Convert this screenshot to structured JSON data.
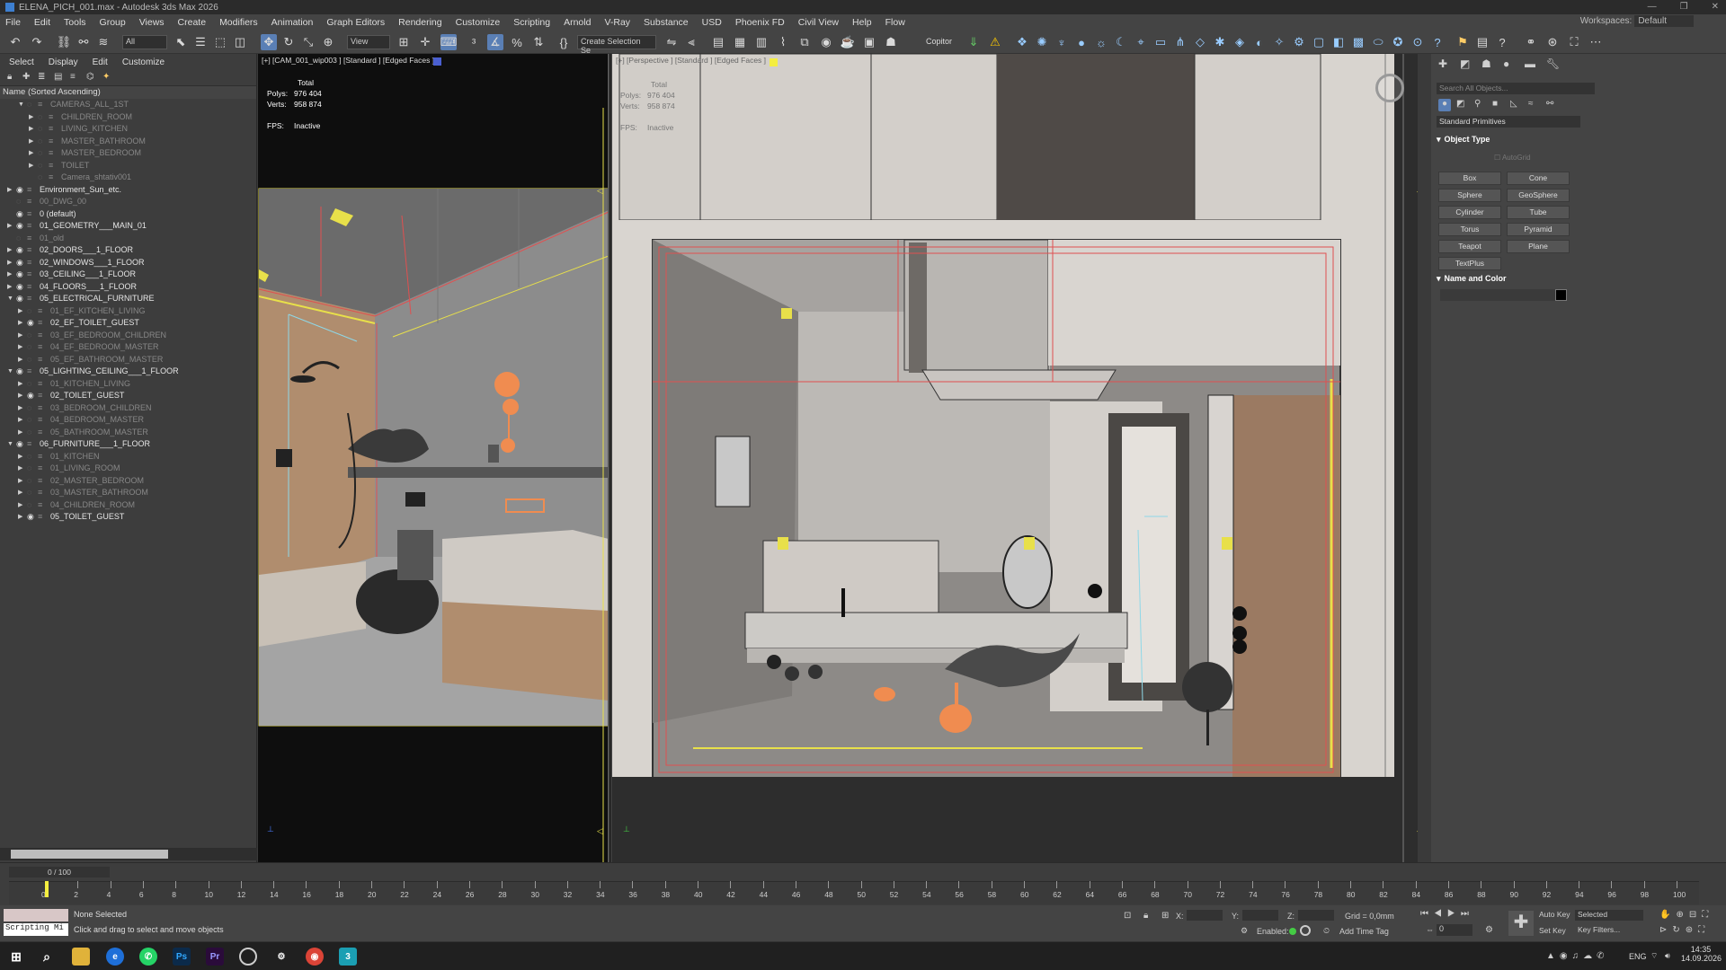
{
  "app": {
    "title": "ELENA_PICH_001.max - Autodesk 3ds Max 2026",
    "workspaces_label": "Workspaces:",
    "workspace": "Default"
  },
  "menu": [
    "File",
    "Edit",
    "Tools",
    "Group",
    "Views",
    "Create",
    "Modifiers",
    "Animation",
    "Graph Editors",
    "Rendering",
    "Customize",
    "Scripting",
    "Arnold",
    "V-Ray",
    "Substance",
    "USD",
    "Phoenix FD",
    "Civil View",
    "Help",
    "Flow"
  ],
  "toolbar": {
    "filter": "All",
    "view_dropdown": "View",
    "selection_set": "Create Selection Se",
    "copitor": "Copitor"
  },
  "scene_explorer": {
    "tabs": [
      "Select",
      "Display",
      "Edit",
      "Customize"
    ],
    "header": "Name (Sorted Ascending)",
    "rows": [
      {
        "label": "CAMERAS_ALL_1ST",
        "lvl": 2,
        "exp": "open",
        "dim": true
      },
      {
        "label": "CHILDREN_ROOM",
        "lvl": 3,
        "exp": "closed",
        "dim": true
      },
      {
        "label": "LIVING_KITCHEN",
        "lvl": 3,
        "exp": "closed",
        "dim": true
      },
      {
        "label": "MASTER_BATHROOM",
        "lvl": 3,
        "exp": "closed",
        "dim": true
      },
      {
        "label": "MASTER_BEDROOM",
        "lvl": 3,
        "exp": "closed",
        "dim": true
      },
      {
        "label": "TOILET",
        "lvl": 3,
        "exp": "closed",
        "dim": true
      },
      {
        "label": "Camera_shtativ001",
        "lvl": 3,
        "exp": "",
        "dim": true
      },
      {
        "label": "Environment_Sun_etc.",
        "lvl": 1,
        "exp": "closed",
        "dim": false
      },
      {
        "label": "00_DWG_00",
        "lvl": 1,
        "exp": "",
        "dim": true
      },
      {
        "label": "0 (default)",
        "lvl": 1,
        "exp": "",
        "dim": false
      },
      {
        "label": "01_GEOMETRY___MAIN_01",
        "lvl": 1,
        "exp": "closed",
        "dim": false
      },
      {
        "label": "01_old",
        "lvl": 1,
        "exp": "",
        "dim": true
      },
      {
        "label": "02_DOORS___1_FLOOR",
        "lvl": 1,
        "exp": "closed",
        "dim": false
      },
      {
        "label": "02_WINDOWS___1_FLOOR",
        "lvl": 1,
        "exp": "closed",
        "dim": false
      },
      {
        "label": "03_CEILING___1_FLOOR",
        "lvl": 1,
        "exp": "closed",
        "dim": false
      },
      {
        "label": "04_FLOORS___1_FLOOR",
        "lvl": 1,
        "exp": "closed",
        "dim": false
      },
      {
        "label": "05_ELECTRICAL_FURNITURE",
        "lvl": 1,
        "exp": "open",
        "dim": false
      },
      {
        "label": "01_EF_KITCHEN_LIVING",
        "lvl": 2,
        "exp": "closed",
        "dim": true
      },
      {
        "label": "02_EF_TOILET_GUEST",
        "lvl": 2,
        "exp": "closed",
        "dim": false
      },
      {
        "label": "03_EF_BEDROOM_CHILDREN",
        "lvl": 2,
        "exp": "closed",
        "dim": true
      },
      {
        "label": "04_EF_BEDROOM_MASTER",
        "lvl": 2,
        "exp": "closed",
        "dim": true
      },
      {
        "label": "05_EF_BATHROOM_MASTER",
        "lvl": 2,
        "exp": "closed",
        "dim": true
      },
      {
        "label": "05_LIGHTING_CEILING___1_FLOOR",
        "lvl": 1,
        "exp": "open",
        "dim": false
      },
      {
        "label": "01_KITCHEN_LIVING",
        "lvl": 2,
        "exp": "closed",
        "dim": true
      },
      {
        "label": "02_TOILET_GUEST",
        "lvl": 2,
        "exp": "closed",
        "dim": false
      },
      {
        "label": "03_BEDROOM_CHILDREN",
        "lvl": 2,
        "exp": "closed",
        "dim": true
      },
      {
        "label": "04_BEDROOM_MASTER",
        "lvl": 2,
        "exp": "closed",
        "dim": true
      },
      {
        "label": "05_BATHROOM_MASTER",
        "lvl": 2,
        "exp": "closed",
        "dim": true
      },
      {
        "label": "06_FURNITURE___1_FLOOR",
        "lvl": 1,
        "exp": "open",
        "dim": false
      },
      {
        "label": "01_KITCHEN",
        "lvl": 2,
        "exp": "closed",
        "dim": true
      },
      {
        "label": "01_LIVING_ROOM",
        "lvl": 2,
        "exp": "closed",
        "dim": true
      },
      {
        "label": "02_MASTER_BEDROOM",
        "lvl": 2,
        "exp": "closed",
        "dim": true
      },
      {
        "label": "03_MASTER_BATHROOM",
        "lvl": 2,
        "exp": "closed",
        "dim": true
      },
      {
        "label": "04_CHILDREN_ROOM",
        "lvl": 2,
        "exp": "closed",
        "dim": true
      },
      {
        "label": "05_TOILET_GUEST",
        "lvl": 2,
        "exp": "closed",
        "dim": false
      }
    ]
  },
  "viewport_left": {
    "label": "[+] [CAM_001_wip003 ] [Standard ] [Edged Faces ]",
    "total": "Total",
    "polys_label": "Polys:",
    "polys": "976 404",
    "verts_label": "Verts:",
    "verts": "958 874",
    "fps_label": "FPS:",
    "fps": "Inactive"
  },
  "viewport_right": {
    "label": "[+] [Perspective ] [Standard ] [Edged Faces ]",
    "total": "Total",
    "polys_label": "Polys:",
    "polys": "976 404",
    "verts_label": "Verts:",
    "verts": "958 874",
    "fps_label": "FPS:",
    "fps": "Inactive"
  },
  "command_panel": {
    "search_placeholder": "Search All Objects...",
    "category": "Standard Primitives",
    "object_type": "Object Type",
    "autogrid": "AutoGrid",
    "buttons": [
      "Box",
      "Cone",
      "Sphere",
      "GeoSphere",
      "Cylinder",
      "Tube",
      "Torus",
      "Pyramid",
      "Teapot",
      "Plane",
      "TextPlus"
    ],
    "name_and_color": "Name and Color"
  },
  "timeline": {
    "frame": "0 / 100",
    "ticks": [
      "0",
      "2",
      "4",
      "6",
      "8",
      "10",
      "12",
      "14",
      "16",
      "18",
      "20",
      "22",
      "24",
      "26",
      "28",
      "30",
      "32",
      "34",
      "36",
      "38",
      "40",
      "42",
      "44",
      "46",
      "48",
      "50",
      "52",
      "54",
      "56",
      "58",
      "60",
      "62",
      "64",
      "66",
      "68",
      "70",
      "72",
      "74",
      "76",
      "78",
      "80",
      "82",
      "84",
      "86",
      "88",
      "90",
      "92",
      "94",
      "96",
      "98",
      "100"
    ]
  },
  "status": {
    "scripting": "Scripting Mi",
    "selection": "None Selected",
    "prompt": "Click and drag to select and move objects",
    "x_label": "X:",
    "y_label": "Y:",
    "z_label": "Z:",
    "grid": "Grid = 0,0mm",
    "enabled": "Enabled:",
    "add_time_tag": "Add Time Tag",
    "auto_key": "Auto Key",
    "selected": "Selected",
    "set_key": "Set Key",
    "key_filters": "Key Filters...",
    "frame_value": "0"
  },
  "taskbar": {
    "lang": "ENG",
    "time": "14:35",
    "date": "14.09.2026"
  },
  "colors": {
    "accent_blue": "#3d7fd0",
    "selection_yellow": "#e8e04a",
    "highlight_red": "#e05050"
  }
}
